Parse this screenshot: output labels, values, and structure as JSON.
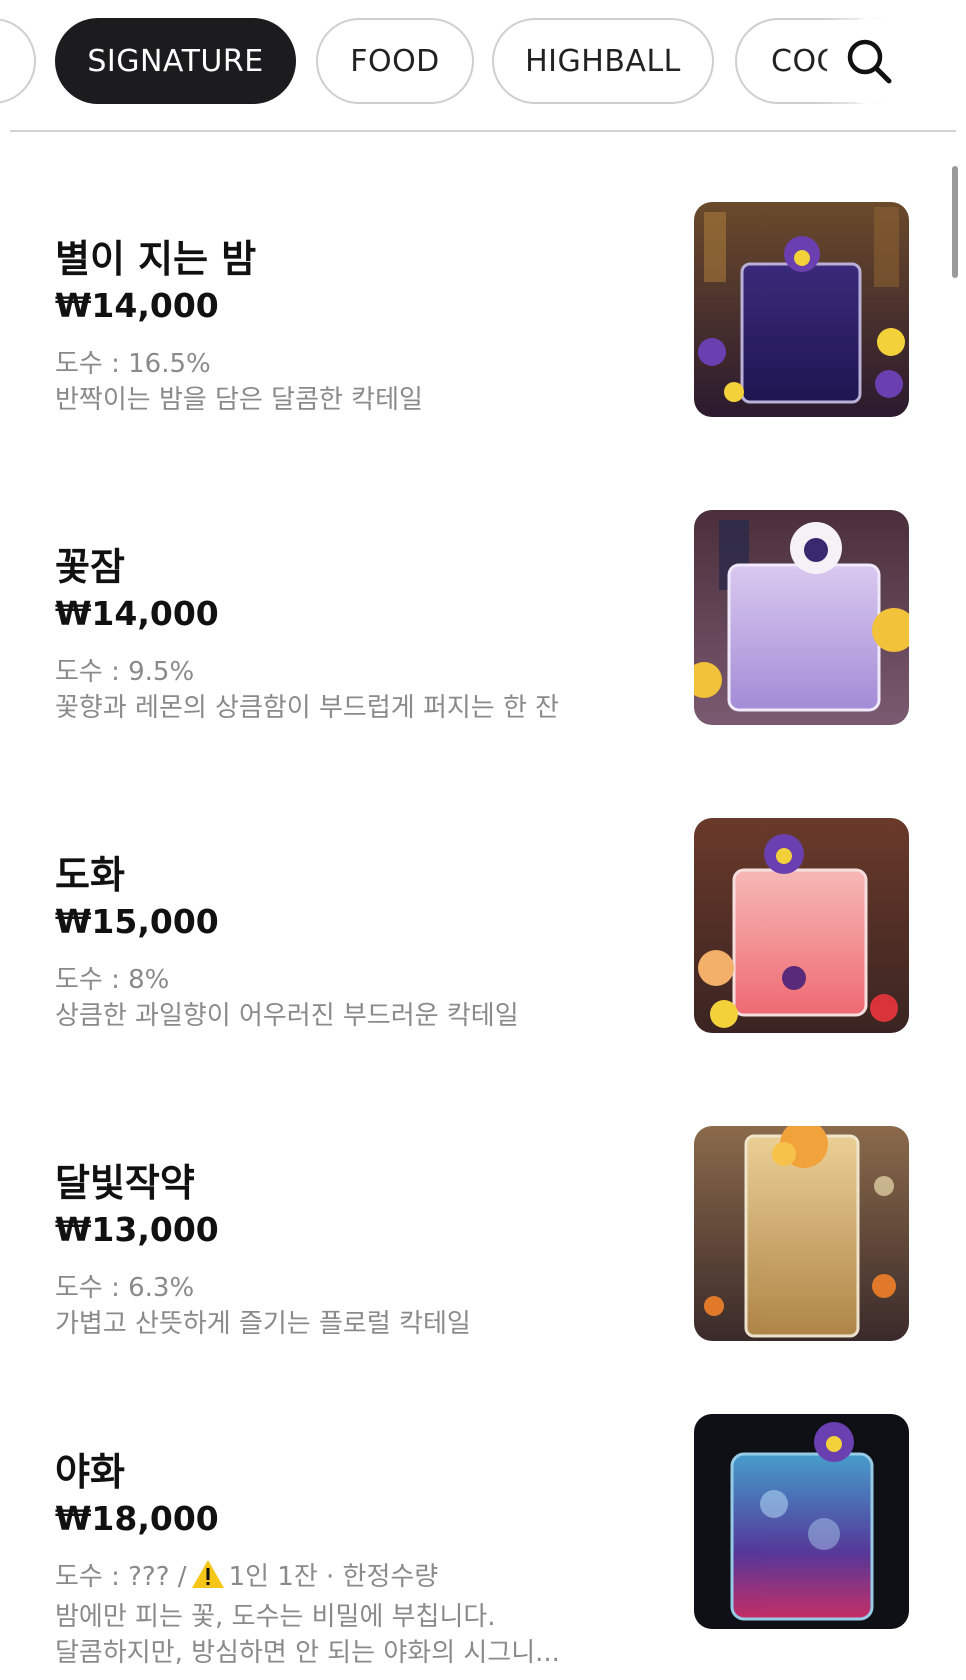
{
  "tabs": [
    {
      "label": ""
    },
    {
      "label": "SIGNATURE"
    },
    {
      "label": "FOOD"
    },
    {
      "label": "HIGHBALL"
    },
    {
      "label": "COC"
    }
  ],
  "search": {
    "icon": "search-icon"
  },
  "menu": [
    {
      "name": "별이 지는 밤",
      "price": "₩14,000",
      "abv": "도수 : 16.5%",
      "desc": [
        "반짝이는 밤을 담은 달콤한 칵테일"
      ]
    },
    {
      "name": "꽃잠",
      "price": "₩14,000",
      "abv": "도수 : 9.5%",
      "desc": [
        "꽃향과 레몬의 상큼함이 부드럽게 퍼지는 한 잔"
      ]
    },
    {
      "name": "도화",
      "price": "₩15,000",
      "abv": "도수 : 8%",
      "desc": [
        "상큼한 과일향이 어우러진 부드러운 칵테일"
      ]
    },
    {
      "name": "달빛작약",
      "price": "₩13,000",
      "abv": "도수 : 6.3%",
      "desc": [
        "가볍고 산뜻하게 즐기는 플로럴 칵테일"
      ]
    },
    {
      "name": "야화",
      "price": "₩18,000",
      "abv": "도수 : ??? /",
      "warning_icon": "warning-icon",
      "abv_note": "1인 1잔 · 한정수량",
      "desc": [
        "밤에만 피는 꽃, 도수는 비밀에 부칩니다.",
        "달콤하지만, 방심하면 안 되는 야화의 시그니..."
      ]
    }
  ],
  "colors": {
    "active_tab": "#1c1c1e",
    "tab_border": "#cfcfcf",
    "meta_text": "#8a8a8a",
    "warning": "#f5c518"
  }
}
